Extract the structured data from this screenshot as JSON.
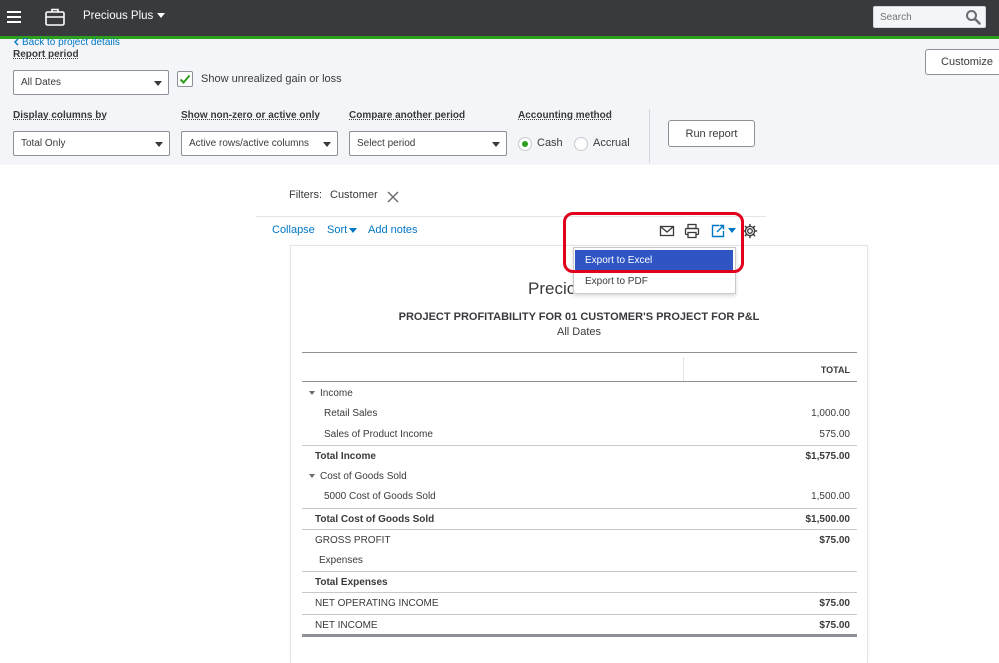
{
  "topbar": {
    "company_name": "Precious Plus",
    "search_placeholder": "Search",
    "icons": {
      "menu": "hamburger-menu-icon",
      "briefcase": "briefcase-icon",
      "search": "search-icon"
    },
    "bar_color": "#393a3d",
    "accent_color": "#2ca01c"
  },
  "panel": {
    "back_link": "Back to project details",
    "report_period_label": "Report period",
    "report_period_value": "All Dates",
    "unrealized_label": "Show unrealized gain or loss",
    "unrealized_checked": true,
    "customize_label": "Customize",
    "display_columns_label": "Display columns by",
    "display_columns_value": "Total Only",
    "non_zero_label": "Show non-zero or active only",
    "non_zero_value": "Active rows/active columns",
    "compare_label": "Compare another period",
    "compare_value": "Select period",
    "accounting_label": "Accounting method",
    "cash_label": "Cash",
    "accrual_label": "Accrual",
    "selected_method": "Cash",
    "run_report_label": "Run report"
  },
  "report": {
    "filters_label": "Filters:",
    "filter_customer": "Customer",
    "toolbar": {
      "collapse": "Collapse",
      "sort": "Sort",
      "add_notes": "Add notes"
    },
    "export_menu": {
      "export_excel": "Export to Excel",
      "export_pdf": "Export to PDF",
      "active_color": "#2f54c3",
      "highlight_color": "#e0001b"
    },
    "company_partial": "Precio",
    "title": "PROJECT PROFITABILITY FOR 01 CUSTOMER'S PROJECT FOR P&L",
    "date_range": "All Dates",
    "column_header": "TOTAL",
    "rows": [
      {
        "label": "Income",
        "amount": ""
      },
      {
        "label": "Retail Sales",
        "amount": "1,000.00"
      },
      {
        "label": "Sales of Product Income",
        "amount": "575.00"
      },
      {
        "label": "Total Income",
        "amount": "$1,575.00"
      },
      {
        "label": "Cost of Goods Sold",
        "amount": ""
      },
      {
        "label": "5000 Cost of Goods Sold",
        "amount": "1,500.00"
      },
      {
        "label": "Total Cost of Goods Sold",
        "amount": "$1,500.00"
      },
      {
        "label": "GROSS PROFIT",
        "amount": "$75.00"
      },
      {
        "label": "Expenses",
        "amount": ""
      },
      {
        "label": "Total Expenses",
        "amount": ""
      },
      {
        "label": "NET OPERATING INCOME",
        "amount": "$75.00"
      },
      {
        "label": "NET INCOME",
        "amount": "$75.00"
      }
    ]
  }
}
